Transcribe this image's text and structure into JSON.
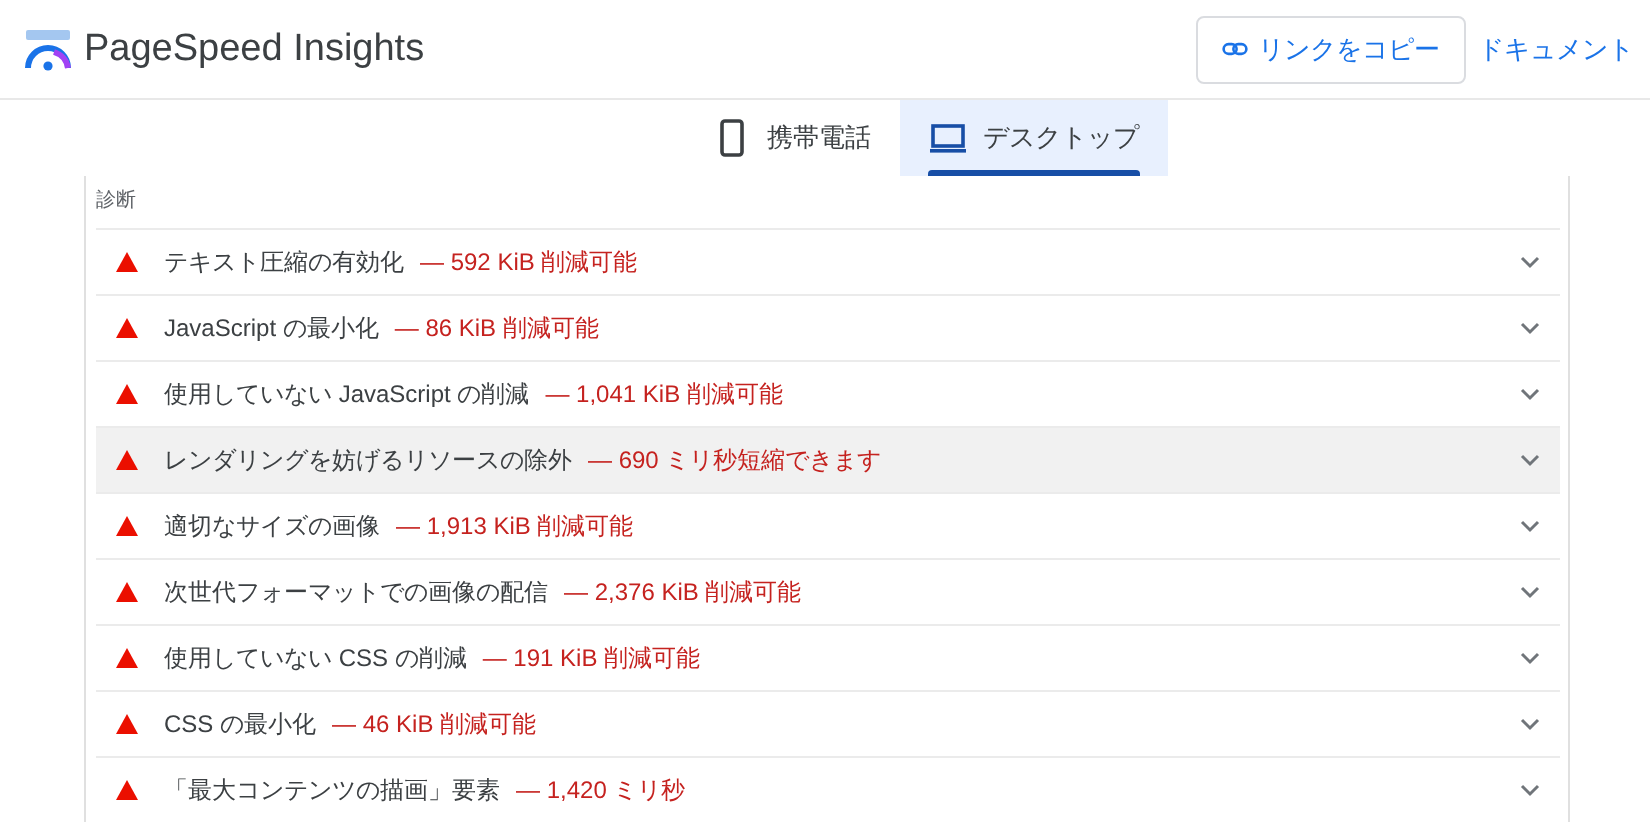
{
  "header": {
    "title": "PageSpeed Insights",
    "copy_link": "リンクをコピー",
    "docs_link": "ドキュメント"
  },
  "tabs": [
    {
      "label": "携帯電話",
      "kind": "mobile",
      "selected": false
    },
    {
      "label": "デスクトップ",
      "kind": "desktop",
      "selected": true
    }
  ],
  "section": {
    "title": "診断"
  },
  "audits": [
    {
      "title": "テキスト圧縮の有効化",
      "savings": "— 592 KiB 削減可能",
      "highlighted": false
    },
    {
      "title": "JavaScript の最小化",
      "savings": "— 86 KiB 削減可能",
      "highlighted": false
    },
    {
      "title": "使用していない JavaScript の削減",
      "savings": "— 1,041 KiB 削減可能",
      "highlighted": false
    },
    {
      "title": "レンダリングを妨げるリソースの除外",
      "savings": "— 690 ミリ秒短縮できます",
      "highlighted": true
    },
    {
      "title": "適切なサイズの画像",
      "savings": "— 1,913 KiB 削減可能",
      "highlighted": false
    },
    {
      "title": "次世代フォーマットでの画像の配信",
      "savings": "— 2,376 KiB 削減可能",
      "highlighted": false
    },
    {
      "title": "使用していない CSS の削減",
      "savings": "— 191 KiB 削減可能",
      "highlighted": false
    },
    {
      "title": "CSS の最小化",
      "savings": "— 46 KiB 削減可能",
      "highlighted": false
    },
    {
      "title": "「最大コンテンツの描画」要素",
      "savings": "— 1,420 ミリ秒",
      "highlighted": false
    }
  ]
}
